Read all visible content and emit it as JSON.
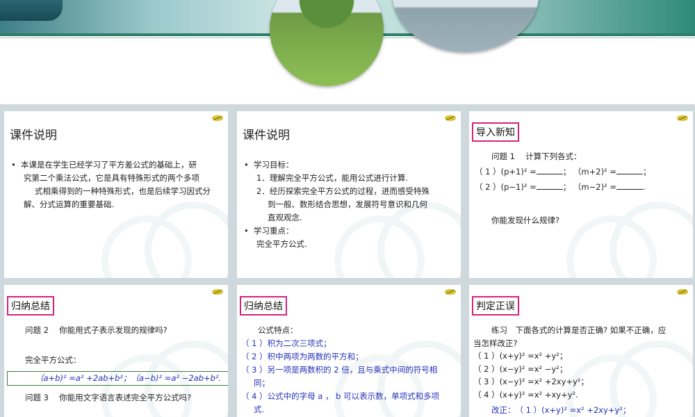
{
  "slides": {
    "s1": {
      "title": "课件说明",
      "b1a": "本课是在学生已经学习了平方差公式的基础上，研",
      "b1b": "究第二个乘法公式，它是具有特殊形式的两个多项",
      "b1c": "式相乘得到的一种特殊形式，也是后续学习因式分",
      "b1d": "解、分式运算的重要基础."
    },
    "s2": {
      "title": "课件说明",
      "goal": "学习目标：",
      "g1": "1．理解完全平方公式，能用公式进行计算.",
      "g2a": "2．经历探索完全平方公式的过程，进而感受特殊",
      "g2b": "到一般、数形结合思想，发展符号意识和几何",
      "g2c": "直观观念.",
      "key": "学习重点：",
      "key_val": "完全平方公式."
    },
    "s3": {
      "title": "导入新知",
      "q": "问题 1　 计算下列各式：",
      "r1a": "（ 1 ）(p+1)² =",
      "r1b": "； （m+2)² =",
      "r1c": "；",
      "r2a": "（ 2 ）(p−1)² =",
      "r2b": "； （m−2)² =",
      "r2c": ".",
      "ask": "你能发现什么规律?"
    },
    "s4": {
      "title": "归纳总结",
      "q2": "问题 2　 你能用式子表示发现的规律吗?",
      "label": "完全平方公式：",
      "formula": "（a+b)² =a² +2ab+b²；（a−b)² =a² −2ab+b².",
      "q3": "问题 3　 你能用文字语言表述完全平方公式吗?"
    },
    "s5": {
      "title": "归纳总结",
      "head": "公式特点：",
      "f1": "（ 1 ）积为二次三项式；",
      "f2": "（ 2 ）积中两项为两数的平方和；",
      "f3a": "（ 3 ）另一项是两数积的 2 倍，且与乘式中间的符号相",
      "f3b": "同；",
      "f4a": "（ 4 ）公式中的字母 a ， b 可以表示数，单项式和多项",
      "f4b": "式."
    },
    "s6": {
      "title": "判定正误",
      "ex1": "练习　下面各式的计算是否正确? 如果不正确，应",
      "ex2": "当怎样改正?",
      "e1": "（ 1 ）(x+y)² =x² +y²；",
      "e2": "（ 2 ）(x−y)² =x² −y²；",
      "e3": "（ 3 ）(x−y)² =x² +2xy+y²；",
      "e4": "（ 4 ）(x+y)² =x² +xy+y².",
      "fix": "改正：　（ 1 ）(x+y)² =x² +2xy+y²；"
    }
  }
}
